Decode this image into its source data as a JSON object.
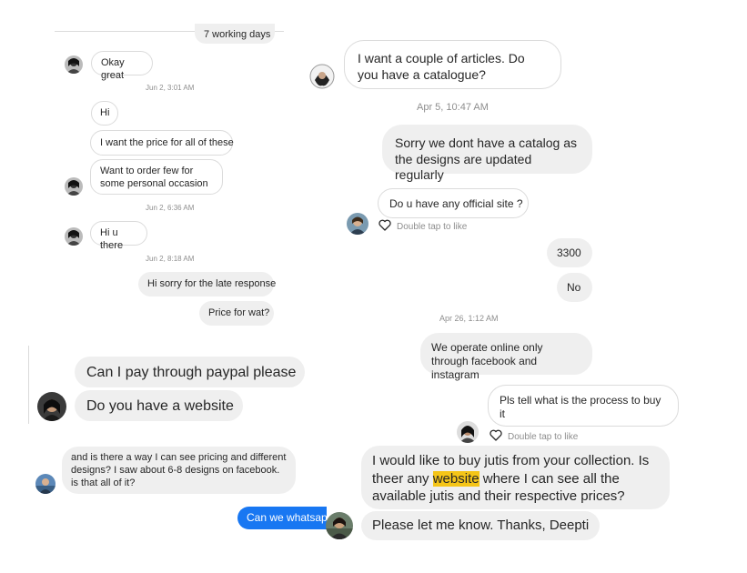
{
  "panel1": {
    "messages": [
      {
        "text": "7 working days"
      },
      {
        "text": "Okay great"
      },
      {
        "text": "Hi"
      },
      {
        "text": "I want the price for all of these"
      },
      {
        "text": "Want to order few for some personal occasion"
      },
      {
        "text": "Hi u there"
      },
      {
        "text": "Hi sorry for the late response"
      },
      {
        "text": "Price for wat?"
      }
    ],
    "timestamps": [
      "Jun 2, 3:01 AM",
      "Jun 2, 6:36 AM",
      "Jun 2, 8:18 AM"
    ]
  },
  "panel2": {
    "messages": [
      {
        "text": "I want a couple of articles.  Do you have a catalogue?"
      },
      {
        "text": "Sorry we dont have a catalog as the designs are updated regularly"
      },
      {
        "text": "Do u have any official site ?"
      },
      {
        "text": "3300"
      },
      {
        "text": "No"
      },
      {
        "text": "We operate online only through facebook and instagram"
      },
      {
        "text": "Pls tell what is the process to buy it"
      }
    ],
    "timestamps": [
      "Apr 5, 10:47 AM",
      "Apr 26, 1:12 AM"
    ],
    "like_hint": "Double tap to like"
  },
  "panel3": {
    "messages": [
      {
        "text": "Can I pay through paypal please"
      },
      {
        "text": "Do you have a website"
      }
    ]
  },
  "panel4": {
    "messages": [
      {
        "text": "and is there a way I can see pricing and different designs? I saw about 6-8 designs on facebook. is that all of it?"
      },
      {
        "text": "Can we whatsapp"
      }
    ]
  },
  "panel5": {
    "message1_part1": "I would like to buy jutis from your collection. Is theer any",
    "message1_highlight": "website",
    "message1_part2": "where I can see all the available jutis and their respective prices?",
    "message2": "Please let me know. Thanks, Deepti"
  },
  "colors": {
    "bubble_gray": "#efefef",
    "bubble_blue": "#1877f2",
    "highlight": "#f5c518",
    "timestamp": "#8e8e8e"
  },
  "icons": [
    "heart-icon",
    "avatar"
  ]
}
